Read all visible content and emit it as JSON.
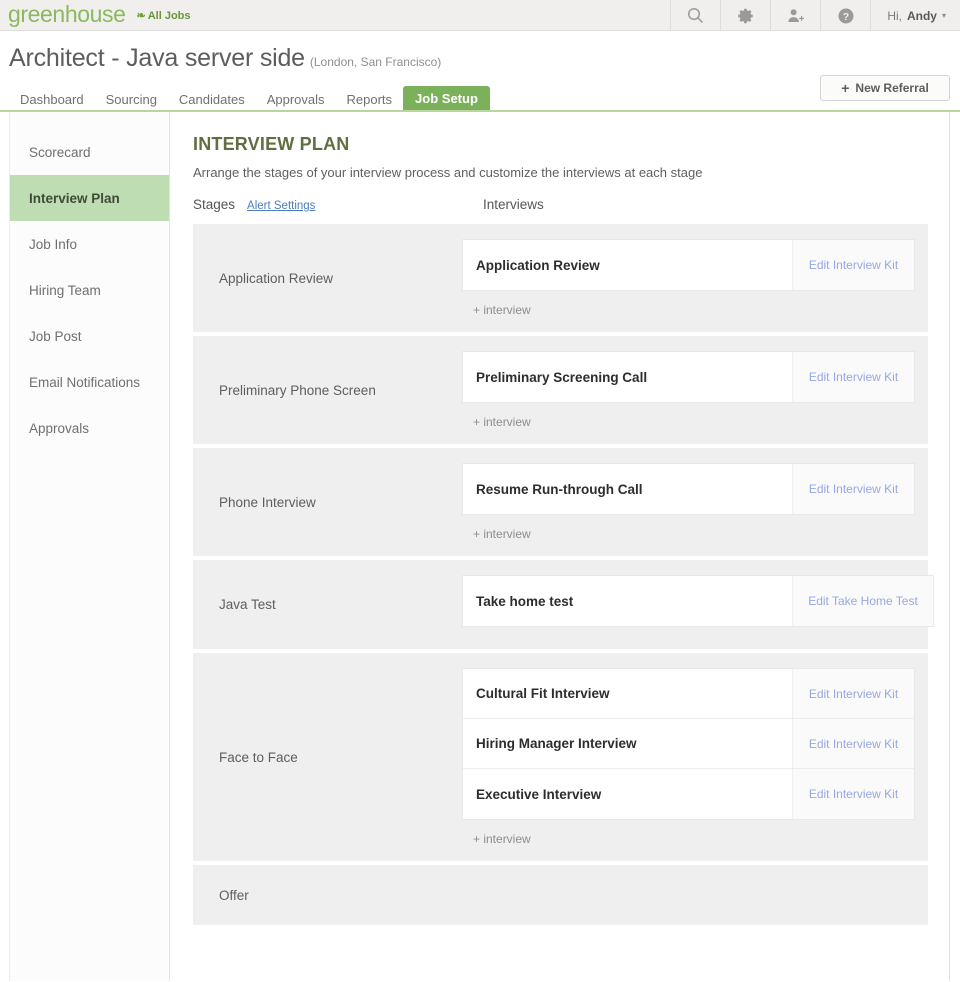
{
  "topbar": {
    "logo": "greenhouse",
    "all_jobs": "All Jobs",
    "leaf_icon": "leaf-icon",
    "search_icon": "search-icon",
    "gear_icon": "gear-icon",
    "add_user_icon": "add-user-icon",
    "help_icon": "help-icon",
    "greeting_prefix": "Hi,",
    "user_name": "Andy",
    "caret": "▾"
  },
  "job": {
    "title": "Architect - Java server side",
    "locations": "(London, San Francisco)",
    "tabs": [
      {
        "label": "Dashboard",
        "active": false
      },
      {
        "label": "Sourcing",
        "active": false
      },
      {
        "label": "Candidates",
        "active": false
      },
      {
        "label": "Approvals",
        "active": false
      },
      {
        "label": "Reports",
        "active": false
      },
      {
        "label": "Job Setup",
        "active": true
      }
    ],
    "new_referral_label": "New Referral",
    "new_referral_plus": "+"
  },
  "sidebar": {
    "items": [
      {
        "label": "Scorecard",
        "active": false
      },
      {
        "label": "Interview Plan",
        "active": true
      },
      {
        "label": "Job Info",
        "active": false
      },
      {
        "label": "Hiring Team",
        "active": false
      },
      {
        "label": "Job Post",
        "active": false
      },
      {
        "label": "Email Notifications",
        "active": false
      },
      {
        "label": "Approvals",
        "active": false
      }
    ]
  },
  "main": {
    "heading": "INTERVIEW PLAN",
    "subtitle": "Arrange the stages of your interview process and customize the interviews at each stage",
    "col_stages": "Stages",
    "col_alert_settings": "Alert Settings",
    "col_interviews": "Interviews",
    "add_interview_label": "+ interview",
    "stages": [
      {
        "name": "Application Review",
        "interviews": [
          {
            "name": "Application Review",
            "edit_label": "Edit Interview Kit",
            "wide": false
          }
        ],
        "show_add": true
      },
      {
        "name": "Preliminary Phone Screen",
        "interviews": [
          {
            "name": "Preliminary Screening Call",
            "edit_label": "Edit Interview Kit",
            "wide": false
          }
        ],
        "show_add": true
      },
      {
        "name": "Phone Interview",
        "interviews": [
          {
            "name": "Resume Run-through Call",
            "edit_label": "Edit Interview Kit",
            "wide": false
          }
        ],
        "show_add": true
      },
      {
        "name": "Java Test",
        "interviews": [
          {
            "name": "Take home test",
            "edit_label": "Edit Take Home Test",
            "wide": true
          }
        ],
        "show_add": false
      },
      {
        "name": "Face to Face",
        "interviews": [
          {
            "name": "Cultural Fit Interview",
            "edit_label": "Edit Interview Kit",
            "wide": false
          },
          {
            "name": "Hiring Manager Interview",
            "edit_label": "Edit Interview Kit",
            "wide": false
          },
          {
            "name": "Executive Interview",
            "edit_label": "Edit Interview Kit",
            "wide": false
          }
        ],
        "show_add": true
      },
      {
        "name": "Offer",
        "interviews": [],
        "show_add": false
      }
    ]
  },
  "colors": {
    "brand_green": "#7cb15c",
    "logo_green": "#8cb85f",
    "active_sidebar": "#bfddb2",
    "link_blue": "#4a7ebb",
    "edit_link": "#98a7e0",
    "heading_green": "#5f7040"
  }
}
